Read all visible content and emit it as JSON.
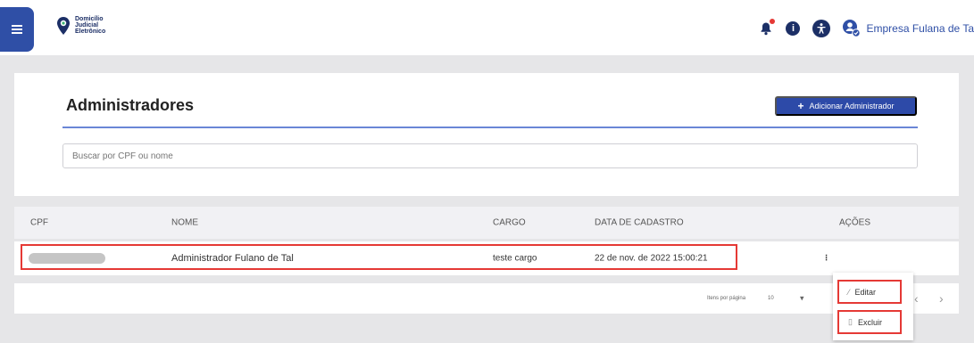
{
  "header": {
    "logo_lines": [
      "Domicílio",
      "Judicial",
      "Eletrônico"
    ],
    "user_name": "Empresa Fulana de Ta",
    "info_icon_glyph": "i"
  },
  "page": {
    "title": "Administradores",
    "add_button_plus": "+",
    "add_button_label": "Adicionar Administrador",
    "search_placeholder": "Buscar por CPF ou nome"
  },
  "table": {
    "columns": [
      "CPF",
      "NOME",
      "CARGO",
      "DATA DE CADASTRO",
      "AÇÕES"
    ],
    "rows": [
      {
        "cpf": "",
        "nome": "Administrador Fulano de Tal",
        "cargo": "teste cargo",
        "data": "22 de nov. de 2022 15:00:21",
        "actions_glyph": "⁝"
      }
    ]
  },
  "pagination": {
    "items_per_page_label": "Itens por página",
    "items_per_page_value": "10",
    "dropdown_glyph": "▾",
    "prev_glyph": "‹",
    "next_glyph": "›"
  },
  "actions_menu": {
    "edit_icon_glyph": "⁄",
    "edit_label": "Editar",
    "delete_icon_glyph": "▯",
    "delete_label": "Excluir"
  },
  "colors": {
    "primary": "#2d4aa8",
    "dark_navy": "#1c2f66",
    "highlight_red": "#e53935",
    "background": "#e6e6e8"
  }
}
